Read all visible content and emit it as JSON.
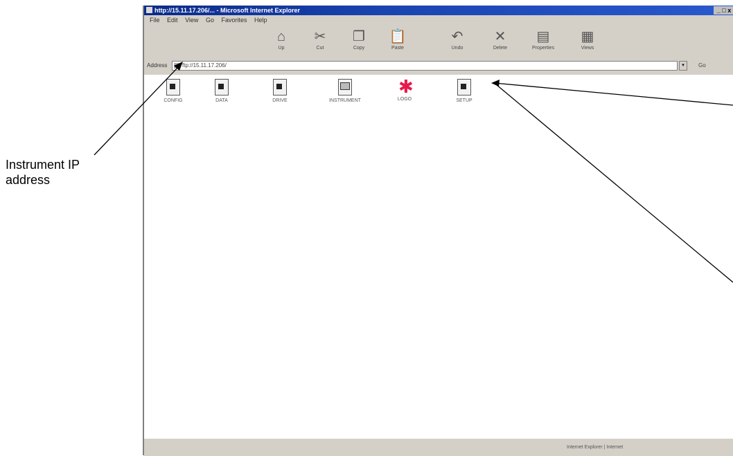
{
  "callout": {
    "line1": "Instrument IP",
    "line2": "address"
  },
  "window": {
    "title": "http://15.11.17.206/...  - Microsoft Internet Explorer",
    "controls": "_ □ x"
  },
  "menu": [
    "File",
    "Edit",
    "View",
    "Go",
    "Favorites",
    "Help"
  ],
  "toolbar": [
    {
      "label": "Up",
      "icon": "up-folder-icon",
      "glyph": "⌂"
    },
    {
      "label": "Cut",
      "icon": "cut-icon",
      "glyph": "✂"
    },
    {
      "label": "Copy",
      "icon": "copy-icon",
      "glyph": "❐"
    },
    {
      "label": "Paste",
      "icon": "paste-icon",
      "glyph": "📋"
    },
    {
      "label": "Undo",
      "icon": "undo-icon",
      "glyph": "↶"
    },
    {
      "label": "Delete",
      "icon": "delete-icon",
      "glyph": "✕"
    },
    {
      "label": "Properties",
      "icon": "properties-icon",
      "glyph": "▤"
    },
    {
      "label": "Views",
      "icon": "views-icon",
      "glyph": "▦"
    }
  ],
  "address": {
    "label": "Address",
    "value": "ftp://15.11.17.206/",
    "go_label": "Go"
  },
  "files": [
    {
      "name": "CONFIG",
      "kind": "document"
    },
    {
      "name": "DATA",
      "kind": "document"
    },
    {
      "name": "DRIVE",
      "kind": "document"
    },
    {
      "name": "INSTRUMENT",
      "kind": "computer"
    },
    {
      "name": "LOGO",
      "kind": "logo"
    },
    {
      "name": "SETUP",
      "kind": "document"
    }
  ],
  "status": {
    "text": "Internet Explorer   |  Internet"
  }
}
